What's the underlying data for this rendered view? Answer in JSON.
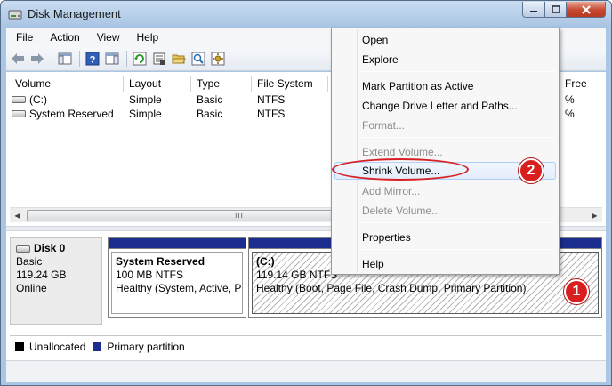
{
  "window": {
    "title": "Disk Management"
  },
  "menu": [
    "File",
    "Action",
    "View",
    "Help"
  ],
  "toolbar": {
    "icons": [
      "back-arrow-icon",
      "forward-arrow-icon",
      "console-tree-icon",
      "help-icon",
      "properties-pane-icon",
      "refresh-icon",
      "properties-icon",
      "open-folder-icon",
      "explore-icon",
      "settings-icon"
    ]
  },
  "volume_list": {
    "columns": [
      "Volume",
      "Layout",
      "Type",
      "File System",
      "",
      "Free"
    ],
    "rows": [
      {
        "volume": "(C:)",
        "layout": "Simple",
        "type": "Basic",
        "fs": "NTFS",
        "free_suffix": "%"
      },
      {
        "volume": "System Reserved",
        "layout": "Simple",
        "type": "Basic",
        "fs": "NTFS",
        "free_suffix": "%"
      }
    ],
    "scroll_thumb": "III"
  },
  "disk": {
    "name": "Disk 0",
    "type": "Basic",
    "size": "119.24 GB",
    "status": "Online",
    "partitions": [
      {
        "name": "System Reserved",
        "size": "100 MB NTFS",
        "status": "Healthy (System, Active, Pr"
      },
      {
        "name": "(C:)",
        "size": "119.14 GB NTFS",
        "status": "Healthy (Boot, Page File, Crash Dump, Primary Partition)"
      }
    ]
  },
  "legend": [
    {
      "label": "Unallocated",
      "color": "#000000"
    },
    {
      "label": "Primary partition",
      "color": "#1b2d8f"
    }
  ],
  "context_menu": {
    "items": [
      {
        "label": "Open",
        "enabled": true
      },
      {
        "label": "Explore",
        "enabled": true
      },
      {
        "label": "Mark Partition as Active",
        "enabled": true
      },
      {
        "label": "Change Drive Letter and Paths...",
        "enabled": true
      },
      {
        "label": "Format...",
        "enabled": false
      },
      {
        "label": "Extend Volume...",
        "enabled": false
      },
      {
        "label": "Shrink Volume...",
        "enabled": true,
        "highlighted": true
      },
      {
        "label": "Add Mirror...",
        "enabled": false
      },
      {
        "label": "Delete Volume...",
        "enabled": false
      },
      {
        "label": "Properties",
        "enabled": true
      },
      {
        "label": "Help",
        "enabled": true
      }
    ]
  },
  "annotations": {
    "step1": "1",
    "step2": "2",
    "color": "#d81e1e"
  }
}
